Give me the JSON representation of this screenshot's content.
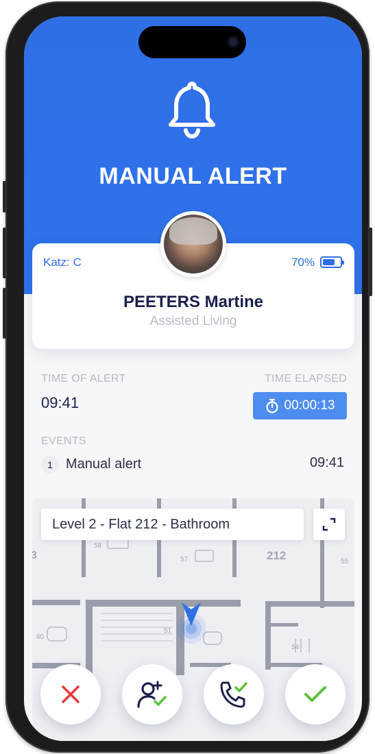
{
  "alert": {
    "title": "MANUAL ALERT",
    "icon": "bell-icon"
  },
  "patient": {
    "category": "Katz: C",
    "battery_pct": "70%",
    "battery_level": 0.7,
    "name": "PEETERS Martine",
    "residence": "Assisted Living"
  },
  "timing": {
    "time_of_alert_label": "TIME OF ALERT",
    "time_of_alert": "09:41",
    "time_elapsed_label": "TIME ELAPSED",
    "time_elapsed": "00:00:13"
  },
  "events": {
    "label": "EVENTS",
    "items": [
      {
        "index": "1",
        "text": "Manual alert",
        "time": "09:41"
      }
    ]
  },
  "map": {
    "location": "Level 2 - Flat 212 - Bathroom",
    "room_number": "212"
  },
  "actions": [
    {
      "name": "cancel",
      "icon": "close-icon"
    },
    {
      "name": "assign",
      "icon": "add-user-check-icon"
    },
    {
      "name": "call",
      "icon": "phone-check-icon"
    },
    {
      "name": "accept",
      "icon": "check-icon"
    }
  ],
  "colors": {
    "primary": "#2f6fe6",
    "elapsed_bg": "#4e8df0",
    "cancel": "#e8363b",
    "confirm": "#5cc23d",
    "text_dark": "#1a1f4a"
  }
}
